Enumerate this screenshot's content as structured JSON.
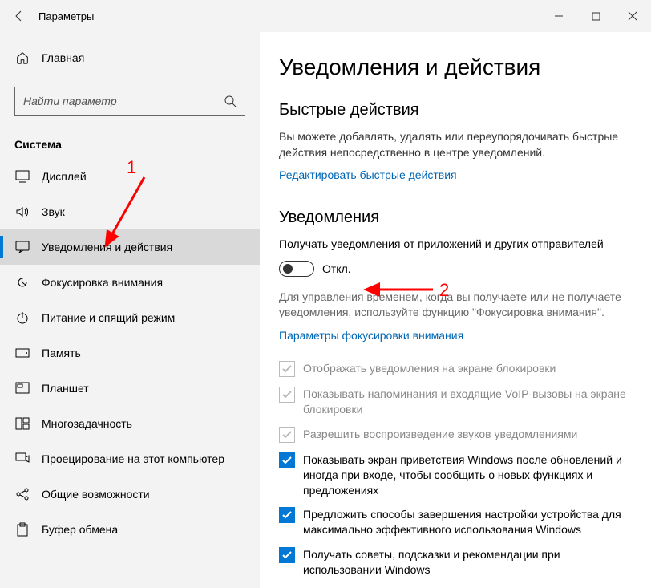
{
  "titlebar": {
    "title": "Параметры"
  },
  "sidebar": {
    "home_label": "Главная",
    "search_placeholder": "Найти параметр",
    "group_label": "Система",
    "items": [
      {
        "label": "Дисплей"
      },
      {
        "label": "Звук"
      },
      {
        "label": "Уведомления и действия"
      },
      {
        "label": "Фокусировка внимания"
      },
      {
        "label": "Питание и спящий режим"
      },
      {
        "label": "Память"
      },
      {
        "label": "Планшет"
      },
      {
        "label": "Многозадачность"
      },
      {
        "label": "Проецирование на этот компьютер"
      },
      {
        "label": "Общие возможности"
      },
      {
        "label": "Буфер обмена"
      }
    ]
  },
  "main": {
    "heading": "Уведомления и действия",
    "quick_actions": {
      "title": "Быстрые действия",
      "desc": "Вы можете добавлять, удалять или переупорядочивать быстрые действия непосредственно в центре уведомлений.",
      "edit_link": "Редактировать быстрые действия"
    },
    "notifications": {
      "title": "Уведомления",
      "toggle_label": "Получать уведомления от приложений и других отправителей",
      "toggle_state_label": "Откл.",
      "focus_note": "Для управления временем, когда вы получаете или не получаете уведомления, используйте функцию \"Фокусировка внимания\".",
      "focus_link": "Параметры фокусировки внимания",
      "checks": [
        {
          "label": "Отображать уведомления на экране блокировки",
          "state": "disabled"
        },
        {
          "label": "Показывать напоминания и входящие VoIP-вызовы на экране блокировки",
          "state": "disabled"
        },
        {
          "label": "Разрешить   воспроизведение звуков уведомлениями",
          "state": "disabled"
        },
        {
          "label": "Показывать экран приветствия Windows после обновлений и иногда при входе, чтобы сообщить о новых функциях и предложениях",
          "state": "on"
        },
        {
          "label": "Предложить способы завершения настройки устройства для максимально эффективного использования Windows",
          "state": "on"
        },
        {
          "label": "Получать советы, подсказки и рекомендации при использовании Windows",
          "state": "on"
        }
      ]
    }
  },
  "annotations": {
    "one": "1",
    "two": "2"
  }
}
